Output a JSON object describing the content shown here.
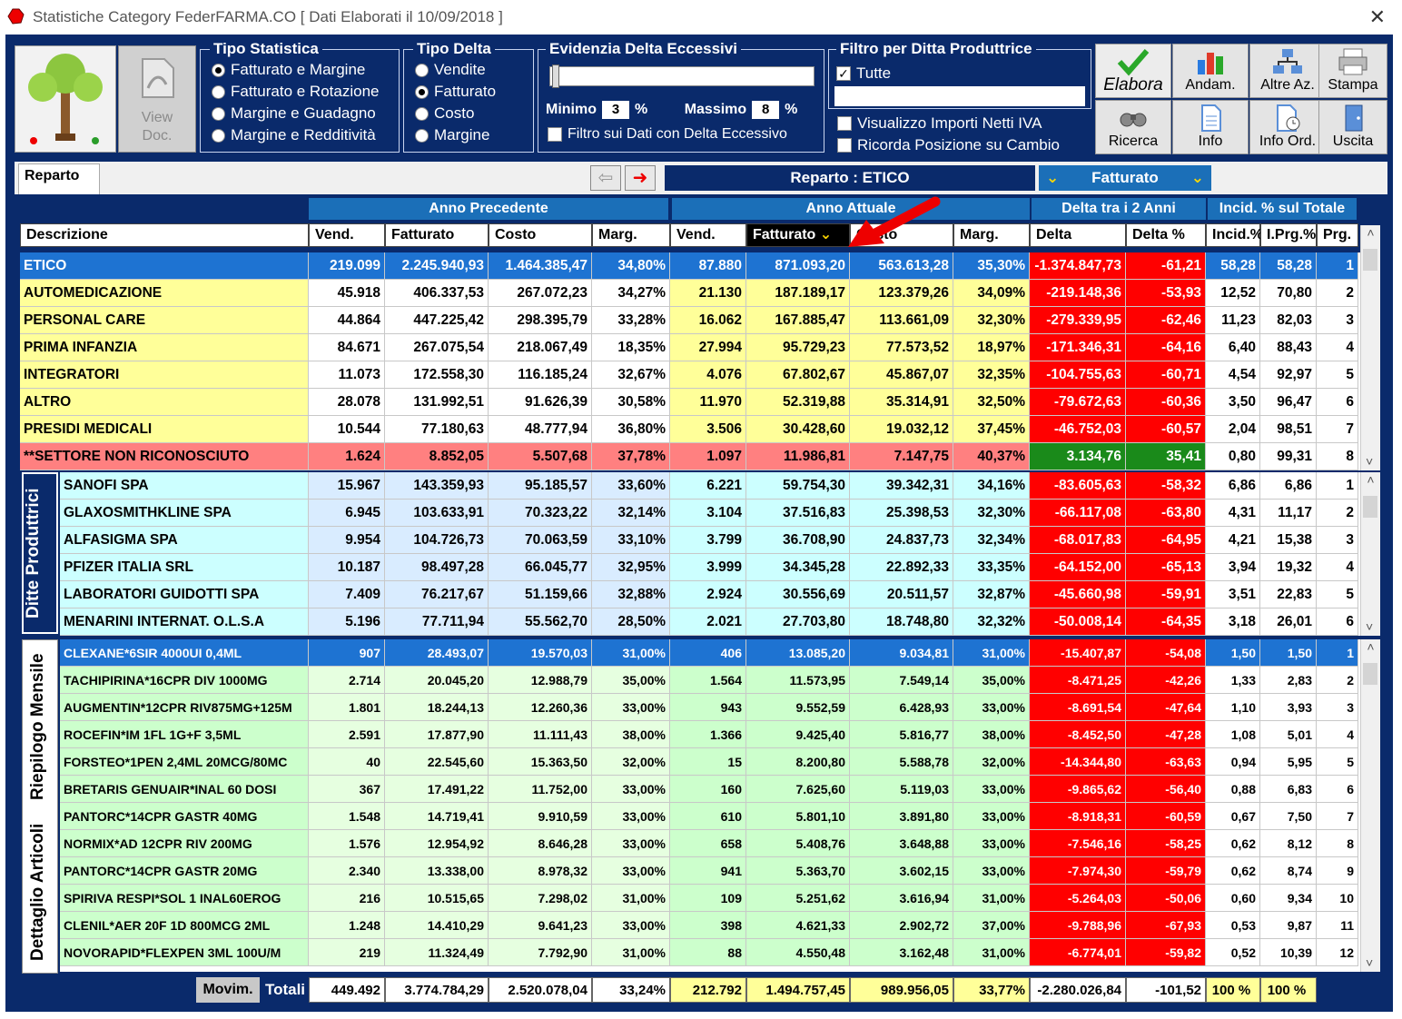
{
  "window": {
    "title": "Statistiche Category FederFARMA.CO [ Dati Elaborati il 10/09/2018 ]",
    "close": "✕"
  },
  "toolbar": {
    "view_doc": [
      "View",
      "Doc."
    ],
    "tipo_statistica": {
      "legend": "Tipo Statistica",
      "options": [
        "Fatturato e Margine",
        "Fatturato e Rotazione",
        "Margine e Guadagno",
        "Margine e Redditività"
      ],
      "selected": 0
    },
    "tipo_delta": {
      "legend": "Tipo Delta",
      "options": [
        "Vendite",
        "Fatturato",
        "Costo",
        "Margine"
      ],
      "selected": 1
    },
    "evidenzia": {
      "legend": "Evidenzia Delta Eccessivi",
      "minimo_label": "Minimo",
      "minimo_value": "3",
      "massimo_label": "Massimo",
      "massimo_value": "8",
      "percent": "%",
      "filtro_label": "Filtro sui Dati con Delta Eccessivo"
    },
    "filtro_ditta": {
      "legend": "Filtro per Ditta Produttrice",
      "tutte": "Tutte",
      "visualizzo": "Visualizzo Importi Netti IVA",
      "ricorda": "Ricorda Posizione su Cambio"
    },
    "buttons": [
      "Elabora",
      "Andam.",
      "Altre Az.",
      "Stampa",
      "Ricerca",
      "Info",
      "Info Ord.",
      "Uscita"
    ]
  },
  "tabs": {
    "reparto": "Reparto",
    "reparto_bar": "Reparto : ETICO",
    "selector": "Fatturato"
  },
  "group_headers": {
    "anno_prec": "Anno Precedente",
    "anno_att": "Anno Attuale",
    "delta": "Delta tra i 2 Anni",
    "incid": "Incid. % sul Totale"
  },
  "columns": [
    "Descrizione",
    "Vend.",
    "Fatturato",
    "Costo",
    "Marg.",
    "Vend.",
    "Fatturato",
    "Costo",
    "Marg.",
    "Delta",
    "Delta %",
    "Incid.%",
    "I.Prg.%",
    "Prg."
  ],
  "reparti": [
    [
      "ETICO",
      "219.099",
      "2.245.940,93",
      "1.464.385,47",
      "34,80%",
      "87.880",
      "871.093,20",
      "563.613,28",
      "35,30%",
      "-1.374.847,73",
      "-61,21",
      "58,28",
      "58,28",
      "1"
    ],
    [
      "AUTOMEDICAZIONE",
      "45.918",
      "406.337,53",
      "267.072,23",
      "34,27%",
      "21.130",
      "187.189,17",
      "123.379,26",
      "34,09%",
      "-219.148,36",
      "-53,93",
      "12,52",
      "70,80",
      "2"
    ],
    [
      "PERSONAL CARE",
      "44.864",
      "447.225,42",
      "298.395,79",
      "33,28%",
      "16.062",
      "167.885,47",
      "113.661,09",
      "32,30%",
      "-279.339,95",
      "-62,46",
      "11,23",
      "82,03",
      "3"
    ],
    [
      "PRIMA INFANZIA",
      "84.671",
      "267.075,54",
      "218.067,49",
      "18,35%",
      "27.994",
      "95.729,23",
      "77.573,52",
      "18,97%",
      "-171.346,31",
      "-64,16",
      "6,40",
      "88,43",
      "4"
    ],
    [
      "INTEGRATORI",
      "11.073",
      "172.558,30",
      "116.185,24",
      "32,67%",
      "4.076",
      "67.802,67",
      "45.867,07",
      "32,35%",
      "-104.755,63",
      "-60,71",
      "4,54",
      "92,97",
      "5"
    ],
    [
      "ALTRO",
      "28.078",
      "131.992,51",
      "91.626,39",
      "30,58%",
      "11.970",
      "52.319,88",
      "35.314,91",
      "32,50%",
      "-79.672,63",
      "-60,36",
      "3,50",
      "96,47",
      "6"
    ],
    [
      "PRESIDI MEDICALI",
      "10.544",
      "77.180,63",
      "48.777,94",
      "36,80%",
      "3.506",
      "30.428,60",
      "19.032,12",
      "37,45%",
      "-46.752,03",
      "-60,57",
      "2,04",
      "98,51",
      "7"
    ],
    [
      "**SETTORE NON RICONOSCIUTO",
      "1.624",
      "8.852,05",
      "5.507,68",
      "37,78%",
      "1.097",
      "11.986,81",
      "7.147,75",
      "40,37%",
      "3.134,76",
      "35,41",
      "0,80",
      "99,31",
      "8"
    ]
  ],
  "ditte_label": "Ditte Produttrici",
  "ditte": [
    [
      "SANOFI SPA",
      "15.967",
      "143.359,93",
      "95.185,57",
      "33,60%",
      "6.221",
      "59.754,30",
      "39.342,31",
      "34,16%",
      "-83.605,63",
      "-58,32",
      "6,86",
      "6,86",
      "1"
    ],
    [
      "GLAXOSMITHKLINE SPA",
      "6.945",
      "103.633,91",
      "70.323,22",
      "32,14%",
      "3.104",
      "37.516,83",
      "25.398,53",
      "32,30%",
      "-66.117,08",
      "-63,80",
      "4,31",
      "11,17",
      "2"
    ],
    [
      "ALFASIGMA SPA",
      "9.954",
      "104.726,73",
      "70.063,59",
      "33,10%",
      "3.799",
      "36.708,90",
      "24.837,73",
      "32,34%",
      "-68.017,83",
      "-64,95",
      "4,21",
      "15,38",
      "3"
    ],
    [
      "PFIZER ITALIA SRL",
      "10.187",
      "98.497,28",
      "66.045,77",
      "32,95%",
      "3.999",
      "34.345,28",
      "22.892,33",
      "33,35%",
      "-64.152,00",
      "-65,13",
      "3,94",
      "19,32",
      "4"
    ],
    [
      "LABORATORI GUIDOTTI SPA",
      "7.409",
      "76.217,67",
      "51.159,66",
      "32,88%",
      "2.924",
      "30.556,69",
      "20.511,57",
      "32,87%",
      "-45.660,98",
      "-59,91",
      "3,51",
      "22,83",
      "5"
    ],
    [
      "MENARINI INTERNAT. O.L.S.A",
      "5.196",
      "77.711,94",
      "55.562,70",
      "28,50%",
      "2.021",
      "27.703,80",
      "18.748,80",
      "32,32%",
      "-50.008,14",
      "-64,35",
      "3,18",
      "26,01",
      "6"
    ]
  ],
  "side_labels": {
    "riepilogo": "Riepilogo Mensile",
    "dettaglio": "Dettaglio Articoli"
  },
  "articoli": [
    [
      "CLEXANE*6SIR 4000UI 0,4ML",
      "907",
      "28.493,07",
      "19.570,03",
      "31,00%",
      "406",
      "13.085,20",
      "9.034,81",
      "31,00%",
      "-15.407,87",
      "-54,08",
      "1,50",
      "1,50",
      "1"
    ],
    [
      "TACHIPIRINA*16CPR DIV 1000MG",
      "2.714",
      "20.045,20",
      "12.988,79",
      "35,00%",
      "1.564",
      "11.573,95",
      "7.549,14",
      "35,00%",
      "-8.471,25",
      "-42,26",
      "1,33",
      "2,83",
      "2"
    ],
    [
      "AUGMENTIN*12CPR RIV875MG+125M",
      "1.801",
      "18.244,13",
      "12.260,36",
      "33,00%",
      "943",
      "9.552,59",
      "6.428,93",
      "33,00%",
      "-8.691,54",
      "-47,64",
      "1,10",
      "3,93",
      "3"
    ],
    [
      "ROCEFIN*IM 1FL 1G+F 3,5ML",
      "2.591",
      "17.877,90",
      "11.111,43",
      "38,00%",
      "1.366",
      "9.425,40",
      "5.816,77",
      "38,00%",
      "-8.452,50",
      "-47,28",
      "1,08",
      "5,01",
      "4"
    ],
    [
      "FORSTEO*1PEN 2,4ML 20MCG/80MC",
      "40",
      "22.545,60",
      "15.363,50",
      "32,00%",
      "15",
      "8.200,80",
      "5.588,78",
      "32,00%",
      "-14.344,80",
      "-63,63",
      "0,94",
      "5,95",
      "5"
    ],
    [
      "BRETARIS GENUAIR*INAL 60 DOSI",
      "367",
      "17.491,22",
      "11.752,00",
      "33,00%",
      "160",
      "7.625,60",
      "5.119,03",
      "33,00%",
      "-9.865,62",
      "-56,40",
      "0,88",
      "6,83",
      "6"
    ],
    [
      "PANTORC*14CPR GASTR 40MG",
      "1.548",
      "14.719,41",
      "9.910,59",
      "33,00%",
      "610",
      "5.801,10",
      "3.891,80",
      "33,00%",
      "-8.918,31",
      "-60,59",
      "0,67",
      "7,50",
      "7"
    ],
    [
      "NORMIX*AD 12CPR RIV 200MG",
      "1.576",
      "12.954,92",
      "8.646,28",
      "33,00%",
      "658",
      "5.408,76",
      "3.648,88",
      "33,00%",
      "-7.546,16",
      "-58,25",
      "0,62",
      "8,12",
      "8"
    ],
    [
      "PANTORC*14CPR GASTR 20MG",
      "2.340",
      "13.338,00",
      "8.978,32",
      "33,00%",
      "941",
      "5.363,70",
      "3.602,15",
      "33,00%",
      "-7.974,30",
      "-59,79",
      "0,62",
      "8,74",
      "9"
    ],
    [
      "SPIRIVA RESPI*SOL 1 INAL60EROG",
      "216",
      "10.515,65",
      "7.298,02",
      "31,00%",
      "109",
      "5.251,62",
      "3.616,94",
      "31,00%",
      "-5.264,03",
      "-50,06",
      "0,60",
      "9,34",
      "10"
    ],
    [
      "CLENIL*AER 20F 1D 800MCG 2ML",
      "1.248",
      "14.410,29",
      "9.641,23",
      "33,00%",
      "398",
      "4.621,33",
      "2.902,72",
      "37,00%",
      "-9.788,96",
      "-67,93",
      "0,53",
      "9,87",
      "11"
    ],
    [
      "NOVORAPID*FLEXPEN 3ML 100U/M",
      "219",
      "11.324,49",
      "7.792,90",
      "31,00%",
      "88",
      "4.550,48",
      "3.162,48",
      "31,00%",
      "-6.774,01",
      "-59,82",
      "0,52",
      "10,39",
      "12"
    ]
  ],
  "totals": {
    "movim": "Movim.",
    "label": "Totali",
    "values": [
      "449.492",
      "3.774.784,29",
      "2.520.078,04",
      "33,24%",
      "212.792",
      "1.494.757,45",
      "989.956,05",
      "33,77%",
      "-2.280.026,84",
      "-101,52",
      "100 %",
      "100 %"
    ]
  },
  "colors": {
    "frame": "#0a2a6b",
    "header_blue": "#1b6fb8",
    "yellow": "#ffff99",
    "cyan": "#ccffff",
    "green": "#ccffcc",
    "red": "#ff0000",
    "selected_row": "#1e73d2"
  }
}
